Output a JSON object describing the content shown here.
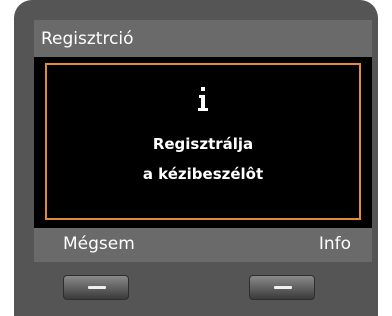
{
  "title_bar": {
    "title": "Regisztrció"
  },
  "dialog": {
    "icon": "info-icon",
    "message_line1": "Regisztrálja",
    "message_line2": "a kézibeszélôt",
    "accent_color": "#e08a3a"
  },
  "softkeys": {
    "left_label": "Mégsem",
    "right_label": "Info"
  }
}
